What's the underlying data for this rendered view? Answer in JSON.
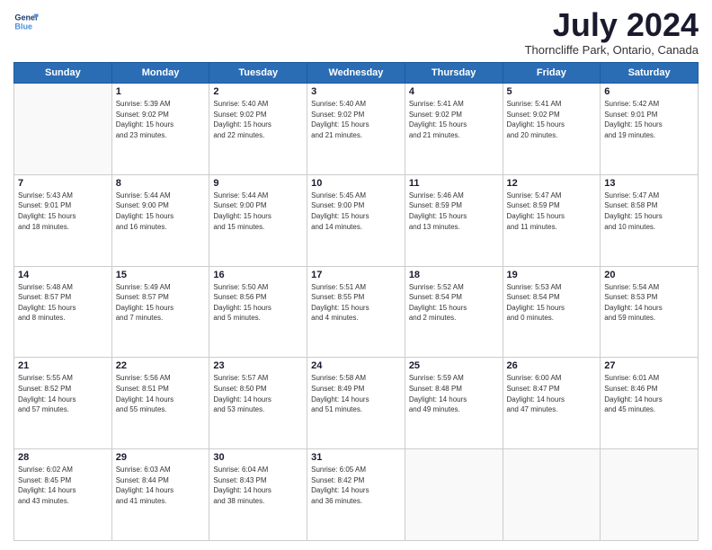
{
  "header": {
    "logo_line1": "General",
    "logo_line2": "Blue",
    "month": "July 2024",
    "location": "Thorncliffe Park, Ontario, Canada"
  },
  "days_of_week": [
    "Sunday",
    "Monday",
    "Tuesday",
    "Wednesday",
    "Thursday",
    "Friday",
    "Saturday"
  ],
  "weeks": [
    [
      {
        "day": "",
        "info": ""
      },
      {
        "day": "1",
        "info": "Sunrise: 5:39 AM\nSunset: 9:02 PM\nDaylight: 15 hours\nand 23 minutes."
      },
      {
        "day": "2",
        "info": "Sunrise: 5:40 AM\nSunset: 9:02 PM\nDaylight: 15 hours\nand 22 minutes."
      },
      {
        "day": "3",
        "info": "Sunrise: 5:40 AM\nSunset: 9:02 PM\nDaylight: 15 hours\nand 21 minutes."
      },
      {
        "day": "4",
        "info": "Sunrise: 5:41 AM\nSunset: 9:02 PM\nDaylight: 15 hours\nand 21 minutes."
      },
      {
        "day": "5",
        "info": "Sunrise: 5:41 AM\nSunset: 9:02 PM\nDaylight: 15 hours\nand 20 minutes."
      },
      {
        "day": "6",
        "info": "Sunrise: 5:42 AM\nSunset: 9:01 PM\nDaylight: 15 hours\nand 19 minutes."
      }
    ],
    [
      {
        "day": "7",
        "info": "Sunrise: 5:43 AM\nSunset: 9:01 PM\nDaylight: 15 hours\nand 18 minutes."
      },
      {
        "day": "8",
        "info": "Sunrise: 5:44 AM\nSunset: 9:00 PM\nDaylight: 15 hours\nand 16 minutes."
      },
      {
        "day": "9",
        "info": "Sunrise: 5:44 AM\nSunset: 9:00 PM\nDaylight: 15 hours\nand 15 minutes."
      },
      {
        "day": "10",
        "info": "Sunrise: 5:45 AM\nSunset: 9:00 PM\nDaylight: 15 hours\nand 14 minutes."
      },
      {
        "day": "11",
        "info": "Sunrise: 5:46 AM\nSunset: 8:59 PM\nDaylight: 15 hours\nand 13 minutes."
      },
      {
        "day": "12",
        "info": "Sunrise: 5:47 AM\nSunset: 8:59 PM\nDaylight: 15 hours\nand 11 minutes."
      },
      {
        "day": "13",
        "info": "Sunrise: 5:47 AM\nSunset: 8:58 PM\nDaylight: 15 hours\nand 10 minutes."
      }
    ],
    [
      {
        "day": "14",
        "info": "Sunrise: 5:48 AM\nSunset: 8:57 PM\nDaylight: 15 hours\nand 8 minutes."
      },
      {
        "day": "15",
        "info": "Sunrise: 5:49 AM\nSunset: 8:57 PM\nDaylight: 15 hours\nand 7 minutes."
      },
      {
        "day": "16",
        "info": "Sunrise: 5:50 AM\nSunset: 8:56 PM\nDaylight: 15 hours\nand 5 minutes."
      },
      {
        "day": "17",
        "info": "Sunrise: 5:51 AM\nSunset: 8:55 PM\nDaylight: 15 hours\nand 4 minutes."
      },
      {
        "day": "18",
        "info": "Sunrise: 5:52 AM\nSunset: 8:54 PM\nDaylight: 15 hours\nand 2 minutes."
      },
      {
        "day": "19",
        "info": "Sunrise: 5:53 AM\nSunset: 8:54 PM\nDaylight: 15 hours\nand 0 minutes."
      },
      {
        "day": "20",
        "info": "Sunrise: 5:54 AM\nSunset: 8:53 PM\nDaylight: 14 hours\nand 59 minutes."
      }
    ],
    [
      {
        "day": "21",
        "info": "Sunrise: 5:55 AM\nSunset: 8:52 PM\nDaylight: 14 hours\nand 57 minutes."
      },
      {
        "day": "22",
        "info": "Sunrise: 5:56 AM\nSunset: 8:51 PM\nDaylight: 14 hours\nand 55 minutes."
      },
      {
        "day": "23",
        "info": "Sunrise: 5:57 AM\nSunset: 8:50 PM\nDaylight: 14 hours\nand 53 minutes."
      },
      {
        "day": "24",
        "info": "Sunrise: 5:58 AM\nSunset: 8:49 PM\nDaylight: 14 hours\nand 51 minutes."
      },
      {
        "day": "25",
        "info": "Sunrise: 5:59 AM\nSunset: 8:48 PM\nDaylight: 14 hours\nand 49 minutes."
      },
      {
        "day": "26",
        "info": "Sunrise: 6:00 AM\nSunset: 8:47 PM\nDaylight: 14 hours\nand 47 minutes."
      },
      {
        "day": "27",
        "info": "Sunrise: 6:01 AM\nSunset: 8:46 PM\nDaylight: 14 hours\nand 45 minutes."
      }
    ],
    [
      {
        "day": "28",
        "info": "Sunrise: 6:02 AM\nSunset: 8:45 PM\nDaylight: 14 hours\nand 43 minutes."
      },
      {
        "day": "29",
        "info": "Sunrise: 6:03 AM\nSunset: 8:44 PM\nDaylight: 14 hours\nand 41 minutes."
      },
      {
        "day": "30",
        "info": "Sunrise: 6:04 AM\nSunset: 8:43 PM\nDaylight: 14 hours\nand 38 minutes."
      },
      {
        "day": "31",
        "info": "Sunrise: 6:05 AM\nSunset: 8:42 PM\nDaylight: 14 hours\nand 36 minutes."
      },
      {
        "day": "",
        "info": ""
      },
      {
        "day": "",
        "info": ""
      },
      {
        "day": "",
        "info": ""
      }
    ]
  ]
}
